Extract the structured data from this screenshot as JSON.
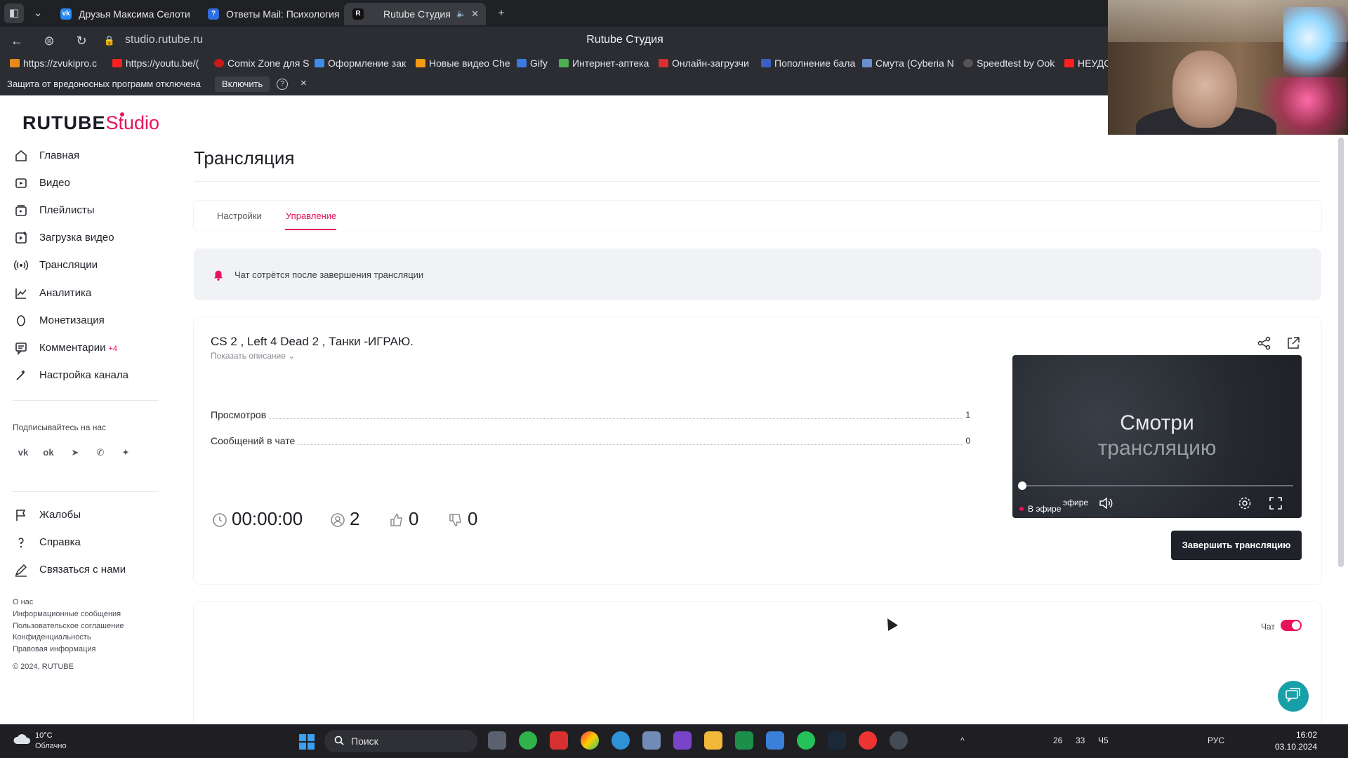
{
  "browser": {
    "tabs": [
      {
        "label": "Друзья Максима Селоти",
        "favicon": "vk-icon"
      },
      {
        "label": "Ответы Mail: Психология",
        "favicon": "mail-answers-icon"
      },
      {
        "label": "Rutube Студия",
        "favicon": "rutube-icon"
      }
    ],
    "url": "studio.rutube.ru",
    "window_title": "Rutube Студия",
    "bookmarks": [
      "https://zvukipro.c",
      "https://youtu.be/(",
      "Comix Zone для S",
      "Оформление зак",
      "Новые видео Che",
      "Gify",
      "Интернет-аптека",
      "Онлайн-загрузчи",
      "Пополнение бала",
      "Смута (Cyberia N",
      "Speedtest by Ook",
      "НЕУДО"
    ],
    "infobar": {
      "text": "Защита от вредоносных программ отключена",
      "button": "Включить",
      "help": "?",
      "close": "×"
    }
  },
  "studio": {
    "logo_main": "RUTUBE",
    "logo_studio": "Studio",
    "nav": [
      {
        "label": "Главная",
        "icon": "home-icon"
      },
      {
        "label": "Видео",
        "icon": "video-icon"
      },
      {
        "label": "Плейлисты",
        "icon": "playlist-icon"
      },
      {
        "label": "Загрузка видео",
        "icon": "upload-icon"
      },
      {
        "label": "Трансляции",
        "icon": "broadcast-icon"
      },
      {
        "label": "Аналитика",
        "icon": "analytics-icon"
      },
      {
        "label": "Монетизация",
        "icon": "monetization-icon"
      },
      {
        "label": "Комментарии",
        "icon": "comments-icon",
        "badge": "+4"
      },
      {
        "label": "Настройка канала",
        "icon": "channel-settings-icon"
      }
    ],
    "subscribe_title": "Подписывайтесь на нас",
    "secondary_nav": [
      {
        "label": "Жалобы",
        "icon": "flag-icon"
      },
      {
        "label": "Справка",
        "icon": "help-icon"
      },
      {
        "label": "Связаться с нами",
        "icon": "contact-icon"
      }
    ],
    "footer_links": [
      "О нас",
      "Информационные сообщения",
      "Пользовательское соглашение",
      "Конфиденциальность",
      "Правовая информация",
      "© 2024, RUTUBE"
    ]
  },
  "main": {
    "title": "Трансляция",
    "tabs": [
      {
        "label": "Настройки",
        "active": false
      },
      {
        "label": "Управление",
        "active": true
      }
    ],
    "notice": "Чат сотрётся после завершения трансляции",
    "stream": {
      "title": "CS 2 , Left 4 Dead 2 , Танки -ИГРАЮ.",
      "show_description": "Показать описание",
      "stats": [
        {
          "label": "Просмотров",
          "value": "1"
        },
        {
          "label": "Сообщений в чате",
          "value": "0"
        }
      ],
      "duration": "00:00:00",
      "viewers": "2",
      "likes": "0",
      "dislikes": "0",
      "player": {
        "line1": "Смотри",
        "line2": "трансляцию",
        "live_label": "В эфире",
        "live_label_overlap": "эфире"
      },
      "end_button": "Завершить трансляцию"
    },
    "chat_label": "Чат",
    "chat_enabled": true
  },
  "taskbar": {
    "weather_temp": "10°C",
    "weather_desc": "Облачно",
    "search_placeholder": "Поиск",
    "tray_numbers": [
      "26",
      "33",
      "Ч5"
    ],
    "language": "РУС",
    "time": "16:02",
    "date": "03.10.2024"
  },
  "colors": {
    "accent": "#e8125c",
    "dark_button": "#1f2229",
    "chrome_bg": "#2b2d33",
    "support_button": "#18a0a8"
  }
}
